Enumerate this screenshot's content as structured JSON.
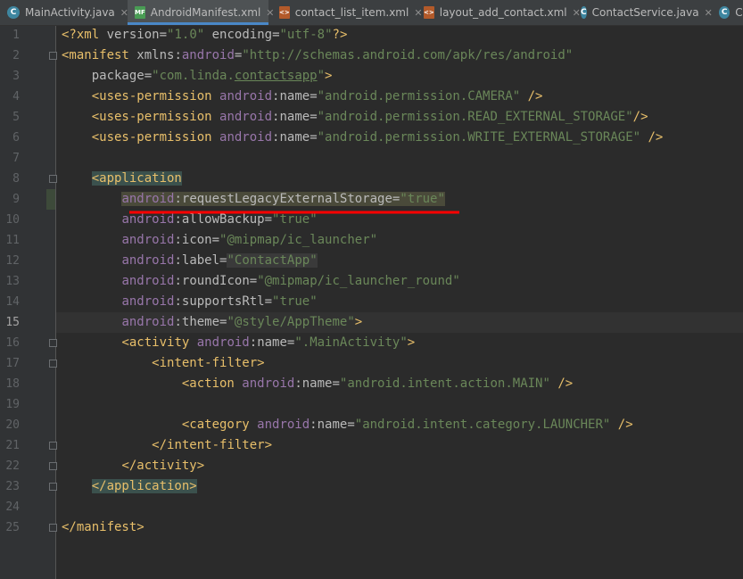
{
  "tabs": [
    {
      "label": "MainActivity.java",
      "icon": "class-c-icon",
      "active": false
    },
    {
      "label": "AndroidManifest.xml",
      "icon": "manifest-icon",
      "active": true
    },
    {
      "label": "contact_list_item.xml",
      "icon": "xml-layout-icon",
      "active": false
    },
    {
      "label": "layout_add_contact.xml",
      "icon": "xml-layout-icon",
      "active": false
    },
    {
      "label": "ContactService.java",
      "icon": "class-c-icon",
      "active": false
    },
    {
      "label": "Co",
      "icon": "class-c-icon",
      "active": false
    }
  ],
  "current_line": 15,
  "line_numbers": [
    "1",
    "2",
    "3",
    "4",
    "5",
    "6",
    "7",
    "8",
    "9",
    "10",
    "11",
    "12",
    "13",
    "14",
    "15",
    "16",
    "17",
    "18",
    "19",
    "20",
    "21",
    "22",
    "23",
    "24",
    "25"
  ],
  "code": {
    "l1": {
      "open": "<?xml ",
      "a1": "version",
      "eq1": "=",
      "v1": "\"1.0\"",
      "sp": " ",
      "a2": "encoding",
      "eq2": "=",
      "v2": "\"utf-8\"",
      "close": "?>"
    },
    "l2": {
      "tag": "<manifest ",
      "a": "xmlns:",
      "ns": "android",
      "eq": "=",
      "v": "\"http://schemas.android.com/apk/res/android\""
    },
    "l3": {
      "a": "package",
      "eq": "=",
      "v_pre": "\"com.linda.",
      "v_ul": "contactsapp",
      "v_post": "\"",
      "close": ">"
    },
    "l4": {
      "tag": "<uses-permission ",
      "ns": "android",
      "col": ":",
      "a": "name",
      "eq": "=",
      "v": "\"android.permission.CAMERA\"",
      "close": " />"
    },
    "l5": {
      "tag": "<uses-permission ",
      "ns": "android",
      "col": ":",
      "a": "name",
      "eq": "=",
      "v": "\"android.permission.READ_EXTERNAL_STORAGE\"",
      "close": "/>"
    },
    "l6": {
      "tag": "<uses-permission ",
      "ns": "android",
      "col": ":",
      "a": "name",
      "eq": "=",
      "v": "\"android.permission.WRITE_EXTERNAL_STORAGE\"",
      "close": " />"
    },
    "l8": {
      "tag": "<application"
    },
    "l9": {
      "ns": "android",
      "col": ":",
      "a": "requestLegacyExternalStorage",
      "eq": "=",
      "v": "\"true\""
    },
    "l10": {
      "ns": "android",
      "col": ":",
      "a": "allowBackup",
      "eq": "=",
      "v": "\"true\""
    },
    "l11": {
      "ns": "android",
      "col": ":",
      "a": "icon",
      "eq": "=",
      "v": "\"@mipmap/ic_launcher\""
    },
    "l12": {
      "ns": "android",
      "col": ":",
      "a": "label",
      "eq": "=",
      "v": "\"ContactApp\""
    },
    "l13": {
      "ns": "android",
      "col": ":",
      "a": "roundIcon",
      "eq": "=",
      "v": "\"@mipmap/ic_launcher_round\""
    },
    "l14": {
      "ns": "android",
      "col": ":",
      "a": "supportsRtl",
      "eq": "=",
      "v": "\"true\""
    },
    "l15": {
      "ns": "android",
      "col": ":",
      "a": "theme",
      "eq": "=",
      "v": "\"@style/AppTheme\"",
      "close": ">"
    },
    "l16": {
      "tag": "<activity ",
      "ns": "android",
      "col": ":",
      "a": "name",
      "eq": "=",
      "v": "\".MainActivity\"",
      "close": ">"
    },
    "l17": {
      "tag": "<intent-filter>"
    },
    "l18": {
      "tag": "<action ",
      "ns": "android",
      "col": ":",
      "a": "name",
      "eq": "=",
      "v": "\"android.intent.action.MAIN\"",
      "close": " />"
    },
    "l20": {
      "tag": "<category ",
      "ns": "android",
      "col": ":",
      "a": "name",
      "eq": "=",
      "v": "\"android.intent.category.LAUNCHER\"",
      "close": " />"
    },
    "l21": {
      "tag": "</intent-filter>"
    },
    "l22": {
      "tag": "</activity>"
    },
    "l23": {
      "tag": "</application>"
    },
    "l25": {
      "tag": "</manifest>"
    }
  },
  "annotation": {
    "color": "#ff0000"
  }
}
